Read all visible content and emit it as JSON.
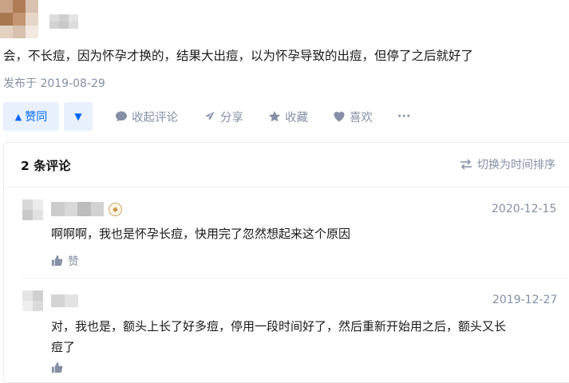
{
  "answer": {
    "text": "会，不长痘，因为怀孕才换的，结果大出痘，以为怀孕导致的出痘，但停了之后就好了",
    "published": "发布于 2019-08-29"
  },
  "actions": {
    "vote_up": "赞同",
    "collapse_comments": "收起评论",
    "share": "分享",
    "favorite": "收藏",
    "like": "喜欢",
    "more": "···"
  },
  "comments": {
    "title": "2 条评论",
    "switch_order": "切换为时间排序",
    "items": [
      {
        "date": "2020-12-15",
        "text": "啊啊啊，我也是怀孕长痘，快用完了忽然想起来这个原因",
        "like_label": "赞"
      },
      {
        "date": "2019-12-27",
        "text_line1": "对，我也是，额头上长了好多痘，停用一段时间好了，然后重新开始用之后，额头又长",
        "text_line2": "痘了"
      }
    ]
  },
  "icons": {
    "vote_up": "triangle-up-icon",
    "vote_down": "triangle-down-icon",
    "comment": "comment-bubble-icon",
    "share": "paper-plane-icon",
    "favorite": "star-icon",
    "like": "heart-icon",
    "switch": "swap-arrows-icon",
    "thumb": "thumb-up-icon",
    "badge": "medal-icon"
  },
  "colors": {
    "accent": "#0066ff",
    "accent_bg": "#e8f1fd",
    "muted": "#8590a6",
    "text": "#121212"
  }
}
